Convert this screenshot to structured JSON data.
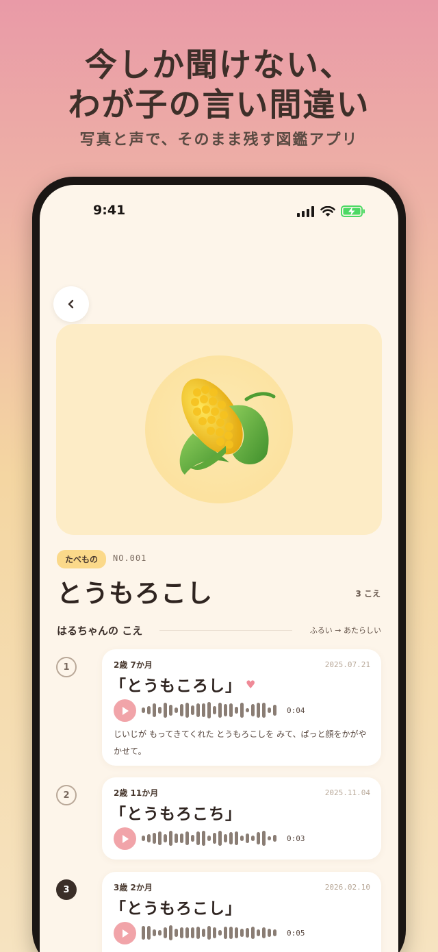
{
  "promo": {
    "headline_line1": "今しか聞けない、",
    "headline_line2": "わが子の言い間違い",
    "subheadline": "写真と声で、そのまま残す図鑑アプリ"
  },
  "status_bar": {
    "time": "9:41"
  },
  "word": {
    "category": "たべもの",
    "number": "NO.001",
    "title": "とうもろこし",
    "voice_count": "3 こえ",
    "image_icon": "corn-icon"
  },
  "section": {
    "title": "はるちゃんの こえ",
    "order": "ふるい → あたらしい"
  },
  "entries": [
    {
      "index": "1",
      "age": "2歳 7か月",
      "date": "2025.07.21",
      "word": "「とうもころし」",
      "favorite": true,
      "duration": "0:04",
      "note": "じいじが もってきてくれた とうもろこしを みて、ぱっと顔をかがやかせて。"
    },
    {
      "index": "2",
      "age": "2歳 11か月",
      "date": "2025.11.04",
      "word": "「とうもろこち」",
      "favorite": false,
      "duration": "0:03",
      "note": ""
    },
    {
      "index": "3",
      "age": "3歳 2か月",
      "date": "2026.02.10",
      "word": "「とうもろこし」",
      "favorite": false,
      "duration": "0:05",
      "note": ""
    }
  ],
  "colors": {
    "accent_pink": "#f1a4a9",
    "tag_yellow": "#fbd98a",
    "battery_green": "#4cd964"
  }
}
